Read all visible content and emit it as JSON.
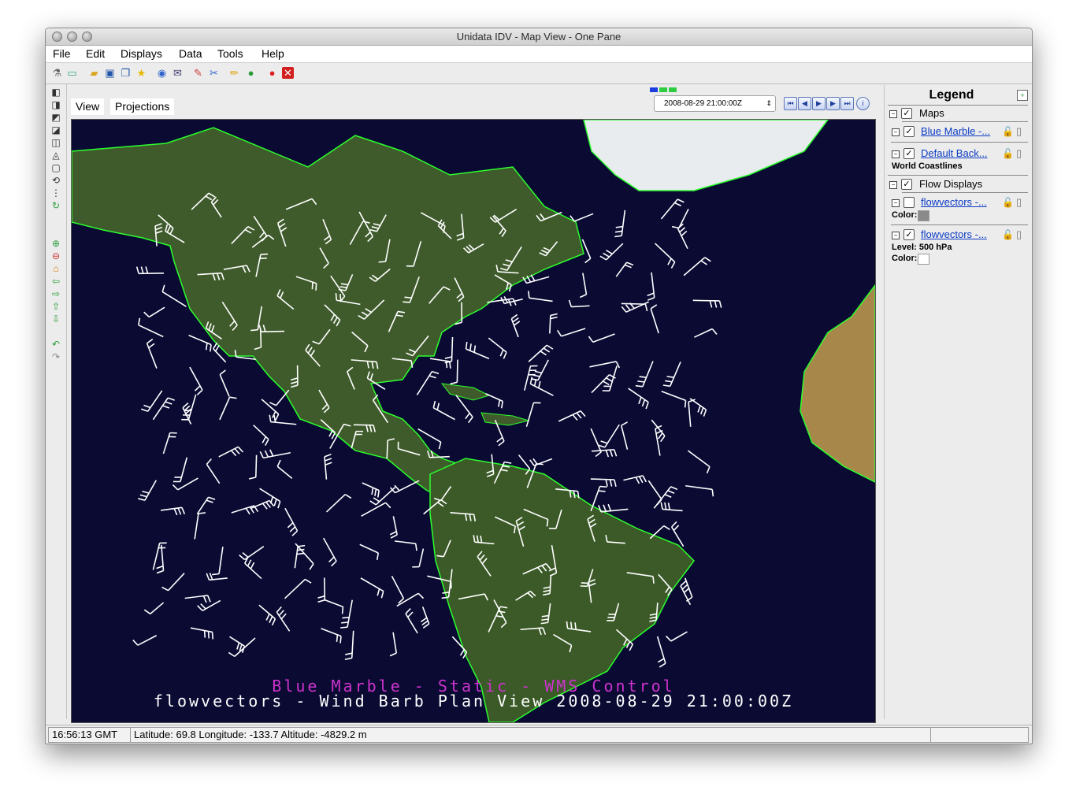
{
  "window": {
    "title": "Unidata IDV - Map View - One Pane"
  },
  "menubar": {
    "items": [
      "File",
      "Edit",
      "Displays",
      "Data",
      "Tools",
      "Help"
    ]
  },
  "toolbar": {
    "icons": [
      "data-chooser-icon",
      "new-window-icon",
      "open-icon",
      "save-icon",
      "save-as-icon",
      "favorites-icon",
      "help-icon",
      "send-mail-icon",
      "eraser-icon",
      "cut-icon",
      "pencil-icon",
      "globe-icon",
      "stop-icon",
      "close-red-icon"
    ]
  },
  "view_tabs": {
    "view": "View",
    "projections": "Projections"
  },
  "animation": {
    "time": "2008-08-29 21:00:00Z"
  },
  "map": {
    "overlay_line1": "Blue Marble - Static - WMS Control",
    "overlay_line2": "flowvectors - Wind Barb Plan View 2008-08-29 21:00:00Z",
    "colors": {
      "ocean": "#0a0a33",
      "land": "#3d5a2a",
      "coast": "#2cff2c",
      "barb": "#ffffff",
      "overlay1": "#cc33cc",
      "overlay2": "#ffffff"
    }
  },
  "legend": {
    "title": "Legend",
    "groups": [
      {
        "label": "Maps",
        "items": [
          {
            "label": "Blue Marble -...",
            "sub": ""
          },
          {
            "label": "Default Back...",
            "sub": "World Coastlines"
          }
        ]
      },
      {
        "label": "Flow Displays",
        "items": [
          {
            "label": "flowvectors -...",
            "color_label": "Color:",
            "color": "#8a8a8a",
            "checked": false
          },
          {
            "label": "flowvectors -...",
            "level_label": "Level: 500 hPa",
            "color_label": "Color:",
            "color": "#ffffff",
            "checked": true
          }
        ]
      }
    ]
  },
  "status": {
    "time": "16:56:13 GMT",
    "position": "Latitude:  69.8   Longitude: -133.7  Altitude: -4829.2 m"
  }
}
